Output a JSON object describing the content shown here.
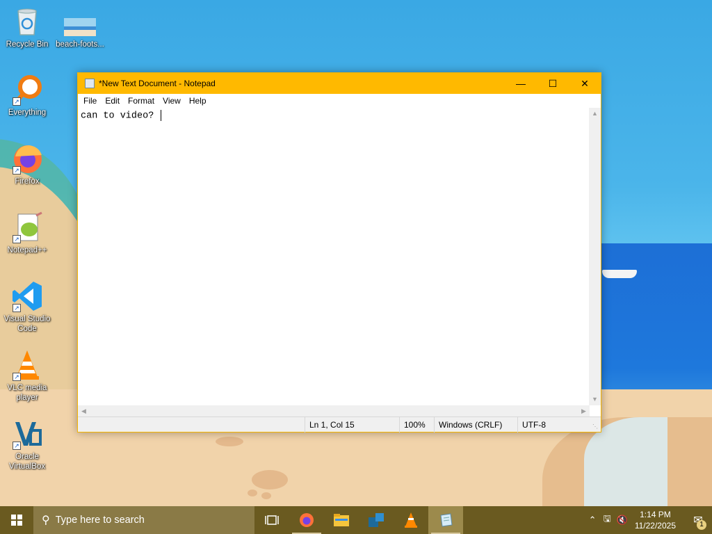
{
  "desktop": {
    "icons": [
      {
        "label": "Recycle Bin",
        "icon": "recycle-bin-icon"
      },
      {
        "label": "beach-foots...",
        "icon": "image-file-icon"
      },
      {
        "label": "Everything",
        "icon": "everything-search-icon"
      },
      {
        "label": "Firefox",
        "icon": "firefox-icon"
      },
      {
        "label": "Notepad++",
        "icon": "notepad-plus-plus-icon"
      },
      {
        "label": "Visual Studio Code",
        "icon": "vscode-icon"
      },
      {
        "label": "VLC media player",
        "icon": "vlc-icon"
      },
      {
        "label": "Oracle VirtualBox",
        "icon": "virtualbox-icon"
      }
    ]
  },
  "notepad": {
    "title": "*New Text Document - Notepad",
    "menu": [
      "File",
      "Edit",
      "Format",
      "View",
      "Help"
    ],
    "content": "can to video? ",
    "status": {
      "position": "Ln 1, Col 15",
      "zoom": "100%",
      "line_ending": "Windows (CRLF)",
      "encoding": "UTF-8"
    },
    "accent_color": "#ffb900"
  },
  "taskbar": {
    "search_placeholder": "Type here to search",
    "apps": [
      "task-view-icon",
      "firefox-icon",
      "file-explorer-icon",
      "virtualbox-icon",
      "vlc-icon",
      "notepad-icon"
    ],
    "clock_time": "1:14 PM",
    "clock_date": "11/22/2025",
    "notification_count": "1"
  }
}
